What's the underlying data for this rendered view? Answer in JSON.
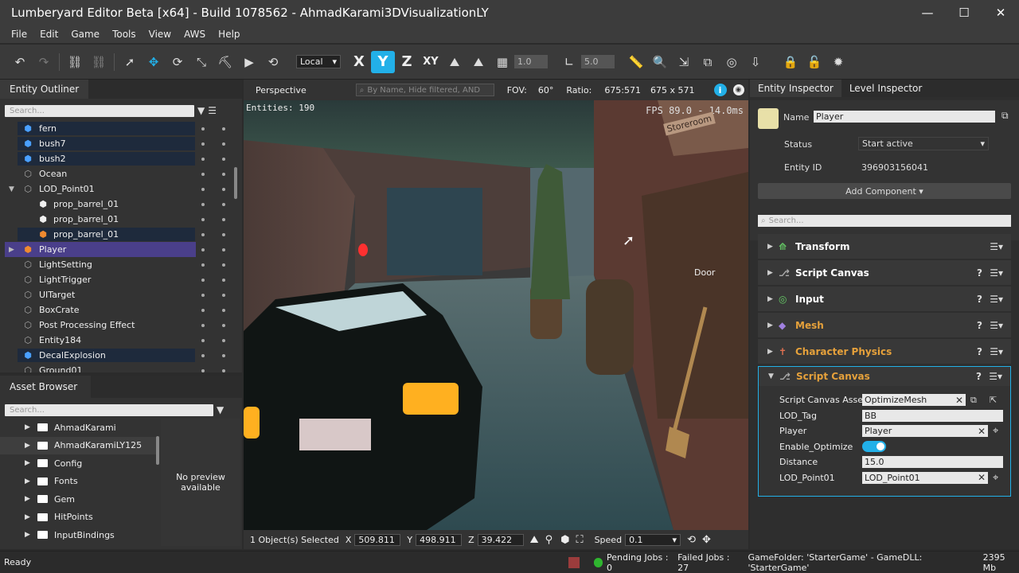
{
  "window": {
    "title": "Lumberyard Editor Beta [x64] - Build 1078562 - AhmadKarami3DVisualizationLY",
    "minimize": "—",
    "maximize": "☐",
    "close": "✕"
  },
  "menu": [
    "File",
    "Edit",
    "Game",
    "Tools",
    "View",
    "AWS",
    "Help"
  ],
  "toolbar": {
    "coord_space": "Local",
    "axes": [
      "X",
      "Y",
      "Z",
      "XY"
    ],
    "active_axis": "Y",
    "grid_size": "1.0",
    "angle_snap": "5.0"
  },
  "outliner": {
    "title": "Entity Outliner",
    "search_placeholder": "Search...",
    "items": [
      {
        "label": "fern",
        "indent": 0,
        "icon": "cube-blue",
        "state": "hl"
      },
      {
        "label": "bush7",
        "indent": 0,
        "icon": "cube-blue",
        "state": "hl"
      },
      {
        "label": "bush2",
        "indent": 0,
        "icon": "cube-blue",
        "state": "hl"
      },
      {
        "label": "Ocean",
        "indent": 0,
        "icon": "cube-outline",
        "state": ""
      },
      {
        "label": "LOD_Point01",
        "indent": 0,
        "icon": "cube-outline",
        "state": "",
        "expanded": true
      },
      {
        "label": "prop_barrel_01",
        "indent": 1,
        "icon": "cube-white",
        "state": ""
      },
      {
        "label": "prop_barrel_01",
        "indent": 1,
        "icon": "cube-white",
        "state": ""
      },
      {
        "label": "prop_barrel_01",
        "indent": 1,
        "icon": "cube-orange",
        "state": "hl"
      },
      {
        "label": "Player",
        "indent": 0,
        "icon": "cube-orange",
        "state": "sel",
        "collapsed": true
      },
      {
        "label": "LightSetting",
        "indent": 0,
        "icon": "cube-outline",
        "state": ""
      },
      {
        "label": "LightTrigger",
        "indent": 0,
        "icon": "cube-outline",
        "state": ""
      },
      {
        "label": "UITarget",
        "indent": 0,
        "icon": "cube-outline",
        "state": ""
      },
      {
        "label": "BoxCrate",
        "indent": 0,
        "icon": "cube-outline",
        "state": ""
      },
      {
        "label": "Post Processing Effect",
        "indent": 0,
        "icon": "cube-outline",
        "state": ""
      },
      {
        "label": "Entity184",
        "indent": 0,
        "icon": "cube-outline",
        "state": ""
      },
      {
        "label": "DecalExplosion",
        "indent": 0,
        "icon": "cube-blue",
        "state": "hl"
      },
      {
        "label": "Ground01",
        "indent": 0,
        "icon": "cube-outline",
        "state": ""
      }
    ]
  },
  "asset_browser": {
    "title": "Asset Browser",
    "search_placeholder": "Search...",
    "folders": [
      "AhmadKarami",
      "AhmadKaramiLY125",
      "Config",
      "Fonts",
      "Gem",
      "HitPoints",
      "InputBindings"
    ],
    "selected_folder": "AhmadKaramiLY125",
    "preview_text": "No preview\navailable"
  },
  "viewport": {
    "tab": "Perspective",
    "search_placeholder": "By Name, Hide filtered, AND",
    "fov_label": "FOV:",
    "fov_value": "60°",
    "ratio_label": "Ratio:",
    "ratio_value": "675:571",
    "resolution": "675 x 571",
    "entities": "Entities: 190",
    "fps": "FPS 89.0 - 14.0ms",
    "door_label": "Door",
    "storeroom_sign": "Storeroom"
  },
  "viewport_status": {
    "selected": "1 Object(s) Selected",
    "x_label": "X",
    "x": "509.811",
    "y_label": "Y",
    "y": "498.911",
    "z_label": "Z",
    "z": "39.422",
    "speed_label": "Speed",
    "speed": "0.1"
  },
  "inspector": {
    "tabs": [
      "Entity Inspector",
      "Level Inspector"
    ],
    "name_label": "Name",
    "name_value": "Player",
    "status_label": "Status",
    "status_value": "Start active",
    "entity_id_label": "Entity ID",
    "entity_id": "396903156041",
    "add_component": "Add Component ▾",
    "search_placeholder": "Search...",
    "components": [
      {
        "name": "Transform",
        "color": "#ffffff",
        "icon": "transform-icon",
        "help": false
      },
      {
        "name": "Script Canvas",
        "color": "#ffffff",
        "icon": "script-canvas-icon",
        "help": true
      },
      {
        "name": "Input",
        "color": "#ffffff",
        "icon": "input-icon",
        "help": true
      },
      {
        "name": "Mesh",
        "color": "#e6a13b",
        "icon": "mesh-icon",
        "help": true
      },
      {
        "name": "Character Physics",
        "color": "#e6a13b",
        "icon": "physics-icon",
        "help": true
      }
    ],
    "expanded_component": {
      "name": "Script Canvas",
      "props": [
        {
          "label": "Script Canvas Asset",
          "value": "OptimizeMesh",
          "kind": "asset"
        },
        {
          "label": "LOD_Tag",
          "value": "BB",
          "kind": "text"
        },
        {
          "label": "Player",
          "value": "Player",
          "kind": "entity"
        },
        {
          "label": "Enable_Optimize",
          "value": "",
          "kind": "toggle"
        },
        {
          "label": "Distance",
          "value": "15.0",
          "kind": "text"
        },
        {
          "label": "LOD_Point01",
          "value": "LOD_Point01",
          "kind": "entity"
        }
      ]
    }
  },
  "statusbar": {
    "left": "Ready",
    "pending": "Pending Jobs : 0",
    "failed": "Failed Jobs : 27",
    "game": "GameFolder: 'StarterGame' - GameDLL: 'StarterGame'",
    "memory": "2395 Mb"
  },
  "colors": {
    "accent": "#22b0e8",
    "selection": "#4a3f8a",
    "highlight": "#1e2a3c",
    "warning": "#e6a13b",
    "ok": "#2fb52f"
  }
}
